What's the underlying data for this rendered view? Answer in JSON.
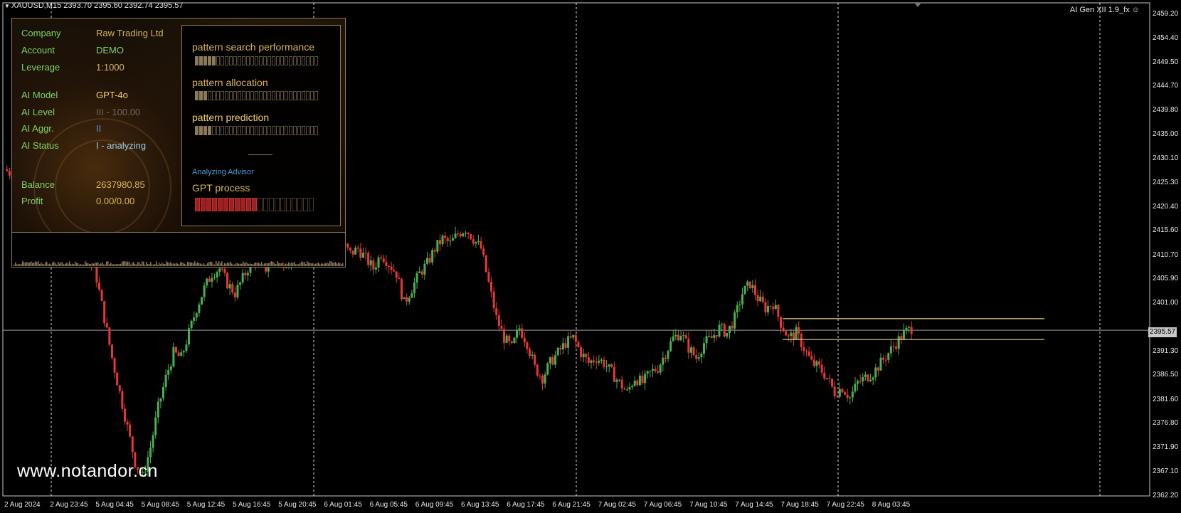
{
  "header": {
    "symbol_line": "XAUUSD,M15  2393.70 2395.60 2392.74 2395.57",
    "ea_label": "AI Gen XII 1.9_fx"
  },
  "colors": {
    "bull": "#4caf50",
    "bear": "#e53935",
    "grid": "#ffffff",
    "level_lines": "#e6d27a",
    "price_line": "#9a9a9a",
    "panel_border": "#8c7a52",
    "key_text": "#7fd36b",
    "gold_text": "#d9b55f"
  },
  "icons": {
    "menu_arrow": "triangle-down-icon",
    "smiley": "smiley-icon"
  },
  "info_panel": {
    "company_label": "Company",
    "company_value": "Raw Trading Ltd",
    "account_label": "Account",
    "account_value": "DEMO",
    "leverage_label": "Leverage",
    "leverage_value": "1:1000",
    "ai_model_label": "AI Model",
    "ai_model_value": "GPT-4o",
    "ai_level_label": "AI Level",
    "ai_level_value": "III - 100.00",
    "ai_aggr_label": "AI Aggr.",
    "ai_aggr_value": "II",
    "ai_status_label": "AI Status",
    "ai_status_value": "I - analyzing",
    "balance_label": "Balance",
    "balance_value": "2637980.85",
    "profit_label": "Profit",
    "profit_value": "0.00/0.00"
  },
  "progress_panel": {
    "search_label": "pattern search performance",
    "search_progress": 0.16,
    "allocation_label": "pattern allocation",
    "allocation_progress": 0.09,
    "prediction_label": "pattern prediction",
    "prediction_progress": 0.13,
    "analyzing_label": "Analyzing Advisor",
    "gpt_label": "GPT process",
    "gpt_progress": 0.5
  },
  "watermark": "www.notandor.cn",
  "current_price": "2395.57",
  "chart_data": {
    "type": "candlestick",
    "symbol": "XAUUSD",
    "timeframe": "M15",
    "ylim": [
      2362.2,
      2461.5
    ],
    "y_ticks": [
      "2459.20",
      "2454.40",
      "2449.50",
      "2444.70",
      "2439.80",
      "2435.00",
      "2430.10",
      "2425.30",
      "2420.40",
      "2415.60",
      "2410.70",
      "2405.90",
      "2401.00",
      "2395.57",
      "2391.30",
      "2386.50",
      "2381.60",
      "2376.80",
      "2371.90",
      "2367.10",
      "2362.20"
    ],
    "x_ticks": [
      "2 Aug 2024",
      "2 Aug 23:45",
      "5 Aug 04:45",
      "5 Aug 08:45",
      "5 Aug 12:45",
      "5 Aug 16:45",
      "5 Aug 20:45",
      "6 Aug 01:45",
      "6 Aug 05:45",
      "6 Aug 09:45",
      "6 Aug 13:45",
      "6 Aug 17:45",
      "6 Aug 21:45",
      "7 Aug 02:45",
      "7 Aug 06:45",
      "7 Aug 10:45",
      "7 Aug 14:45",
      "7 Aug 18:45",
      "7 Aug 22:45",
      "8 Aug 03:45"
    ],
    "current_price": 2395.57,
    "level_lines": [
      2397.9,
      2393.7
    ],
    "close_path": [
      2428,
      2427,
      2426,
      2424,
      2426,
      2430,
      2431,
      2430,
      2428,
      2426,
      2418,
      2410,
      2406,
      2398,
      2390,
      2383,
      2376,
      2369,
      2366,
      2372,
      2380,
      2386,
      2391,
      2390,
      2395,
      2400,
      2404,
      2407,
      2408,
      2405,
      2403,
      2406,
      2409,
      2410,
      2408,
      2411,
      2409,
      2410,
      2412,
      2410,
      2413,
      2415,
      2417,
      2416,
      2413,
      2411,
      2412,
      2410,
      2408,
      2411,
      2409,
      2407,
      2401,
      2404,
      2407,
      2409,
      2412,
      2414,
      2413,
      2415,
      2416,
      2414,
      2412,
      2405,
      2398,
      2394,
      2392,
      2396,
      2393,
      2388,
      2386,
      2389,
      2391,
      2393,
      2394,
      2391,
      2389,
      2390,
      2389,
      2387,
      2385,
      2383,
      2386,
      2385,
      2387,
      2388,
      2391,
      2394,
      2395,
      2392,
      2390,
      2393,
      2394,
      2396,
      2395,
      2398,
      2403,
      2405,
      2402,
      2400,
      2401,
      2397,
      2394,
      2395,
      2392,
      2389,
      2388,
      2386,
      2383,
      2384,
      2382,
      2385,
      2386,
      2387,
      2389,
      2391,
      2393,
      2395,
      2396
    ]
  }
}
